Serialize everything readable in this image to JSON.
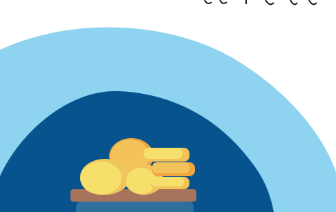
{
  "colors": {
    "background": "#ffffff",
    "outer_arc": "#8ed3ef",
    "inner_arc": "#06538e",
    "jar_body": "#2f6f9e",
    "jar_lid": "#a8735b",
    "coin_light": "#f6df6b",
    "coin_mid": "#f3c25a",
    "coin_orange": "#f0a53d",
    "text_fragment": "#1b1b1b"
  },
  "icons": {
    "illustration": "coin-jar-illustration"
  }
}
